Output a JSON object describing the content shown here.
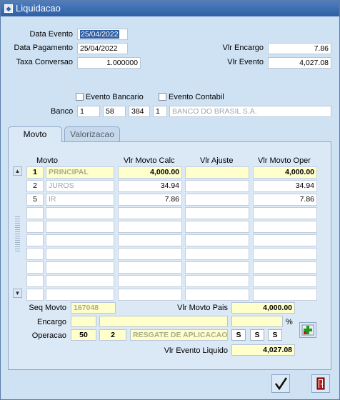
{
  "window": {
    "title": "Liquidacao"
  },
  "header": {
    "data_evento_label": "Data Evento",
    "data_evento": "25/04/2022",
    "data_pagamento_label": "Data Pagamento",
    "data_pagamento": "25/04/2022",
    "taxa_conversao_label": "Taxa Conversao",
    "taxa_conversao": "1.000000",
    "vlr_encargo_label": "Vlr Encargo",
    "vlr_encargo": "7.86",
    "vlr_evento_label": "Vlr Evento",
    "vlr_evento": "4,027.08"
  },
  "flags": {
    "evento_bancario": "Evento Bancario",
    "evento_contabil": "Evento Contabil"
  },
  "banco": {
    "label": "Banco",
    "code1": "1",
    "code2": "58",
    "code3": "384",
    "code4": "1",
    "name": "BANCO DO BRASIL S.A."
  },
  "tabs": [
    {
      "label": "Movto"
    },
    {
      "label": "Valorizacao"
    }
  ],
  "table": {
    "headers": {
      "movto": "Movto",
      "calc": "Vlr Movto Calc",
      "ajuste": "Vlr Ajuste",
      "oper": "Vlr Movto Oper"
    },
    "rows": [
      {
        "code": "1",
        "name": "PRINCIPAL",
        "calc": "4,000.00",
        "ajuste": "",
        "oper": "4,000.00"
      },
      {
        "code": "2",
        "name": "JUROS",
        "calc": "34.94",
        "ajuste": "",
        "oper": "34.94"
      },
      {
        "code": "5",
        "name": "IR",
        "calc": "7.86",
        "ajuste": "",
        "oper": "7.86"
      }
    ]
  },
  "bottom": {
    "seq_movto_label": "Seq Movto",
    "seq_movto": "167048",
    "vlr_movto_pais_label": "Vlr Movto Pais",
    "vlr_movto_pais": "4,000.00",
    "encargo_label": "Encargo",
    "percent": "%",
    "operacao_label": "Operacao",
    "operacao_code1": "50",
    "operacao_code2": "2",
    "operacao_desc": "RESGATE DE APLICACAO",
    "s1": "S",
    "s2": "S",
    "s3": "S",
    "vlr_evento_liquido_label": "Vlr Evento Liquido",
    "vlr_evento_liquido": "4,027.08"
  },
  "icons": {
    "add": "plus-icon",
    "ok": "checkmark-icon",
    "exit": "exit-door-icon",
    "app": "app-icon"
  }
}
